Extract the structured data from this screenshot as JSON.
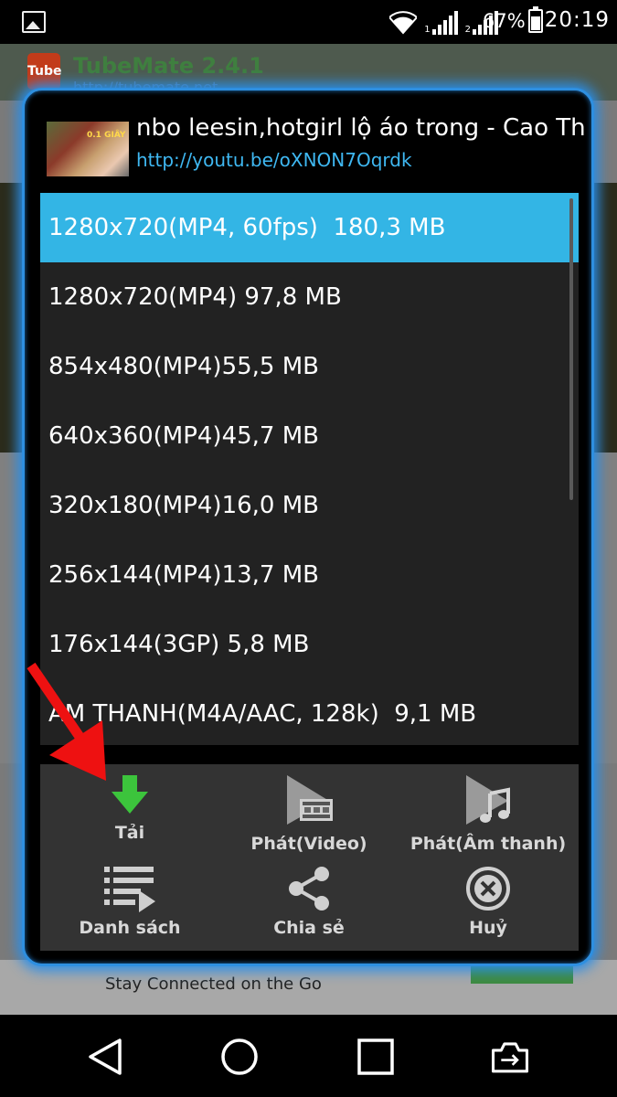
{
  "status_bar": {
    "battery_text": "67%",
    "time": "20:19",
    "sim1": "1",
    "sim2": "2"
  },
  "background_app": {
    "logo_text": "Tube M",
    "title": "TubeMate 2.4.1",
    "url": "http://tubemate.net",
    "ad_text": "Stay Connected on the Go"
  },
  "dialog": {
    "thumbnail_text": "0.1 GIÂY",
    "video_title": "nbo leesin,hotgirl lộ áo trong - Cao Th",
    "video_url": "http://youtu.be/oXNON7Oqrdk",
    "formats": [
      {
        "label": "1280x720(MP4, 60fps)  180,3 MB",
        "selected": true
      },
      {
        "label": "1280x720(MP4) 97,8 MB",
        "selected": false
      },
      {
        "label": "854x480(MP4)55,5 MB",
        "selected": false
      },
      {
        "label": "640x360(MP4)45,7 MB",
        "selected": false
      },
      {
        "label": "320x180(MP4)16,0 MB",
        "selected": false
      },
      {
        "label": "256x144(MP4)13,7 MB",
        "selected": false
      },
      {
        "label": "176x144(3GP) 5,8 MB",
        "selected": false
      },
      {
        "label": "ÂM THANH(M4A/AAC, 128k)  9,1 MB",
        "selected": false
      }
    ],
    "actions": {
      "download": "Tải",
      "play_video": "Phát(Video)",
      "play_audio": "Phát(Âm thanh)",
      "playlist": "Danh sách",
      "share": "Chia sẻ",
      "cancel": "Huỷ"
    }
  },
  "colors": {
    "accent_blue": "#33b5e5",
    "dialog_border": "#2e8fe0",
    "link": "#3fb8f2",
    "download_green": "#3cc43c",
    "annotation_red": "#ee1111"
  }
}
